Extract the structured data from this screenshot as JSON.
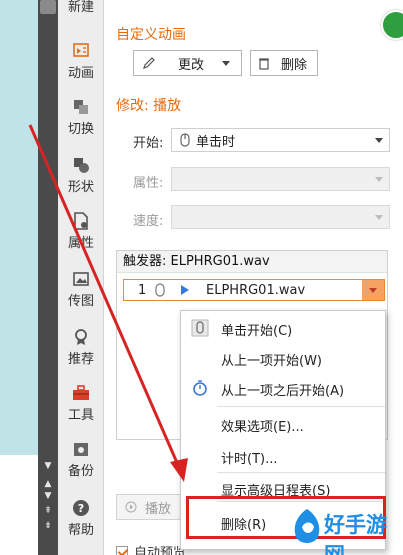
{
  "toolbar": {
    "items": [
      {
        "label": "新建",
        "icon": "new-icon"
      },
      {
        "label": "动画",
        "icon": "animation-icon"
      },
      {
        "label": "切换",
        "icon": "transition-icon"
      },
      {
        "label": "形状",
        "icon": "shape-icon"
      },
      {
        "label": "属性",
        "icon": "property-icon"
      },
      {
        "label": "传图",
        "icon": "upload-image-icon"
      },
      {
        "label": "推荐",
        "icon": "recommend-icon"
      },
      {
        "label": "工具",
        "icon": "toolbox-icon"
      },
      {
        "label": "备份",
        "icon": "backup-icon"
      },
      {
        "label": "帮助",
        "icon": "help-icon"
      }
    ]
  },
  "panel": {
    "custom_title": "自定义动画",
    "change_label": "更改",
    "delete_label": "删除",
    "modify_title": "修改: 播放",
    "start_label": "开始:",
    "start_value": "单击时",
    "property_label": "属性:",
    "speed_label": "速度:",
    "trigger_label": "触发器: ELPHRG01.wav",
    "anim_index": "1",
    "anim_name": "ELPHRG01.wav",
    "play_label": "播放",
    "auto_preview_label": "自动预览"
  },
  "menu": {
    "items": [
      {
        "label": "单击开始(C)"
      },
      {
        "label": "从上一项开始(W)"
      },
      {
        "label": "从上一项之后开始(A)"
      },
      {
        "label": "效果选项(E)..."
      },
      {
        "label": "计时(T)..."
      },
      {
        "label": "显示高级日程表(S)"
      },
      {
        "label": "删除(R)"
      }
    ]
  },
  "watermark": {
    "text": "好手游网"
  },
  "colors": {
    "accent_orange": "#e86a0c",
    "arrow_red": "#d82323",
    "watermark_blue": "#1f8fe6"
  }
}
